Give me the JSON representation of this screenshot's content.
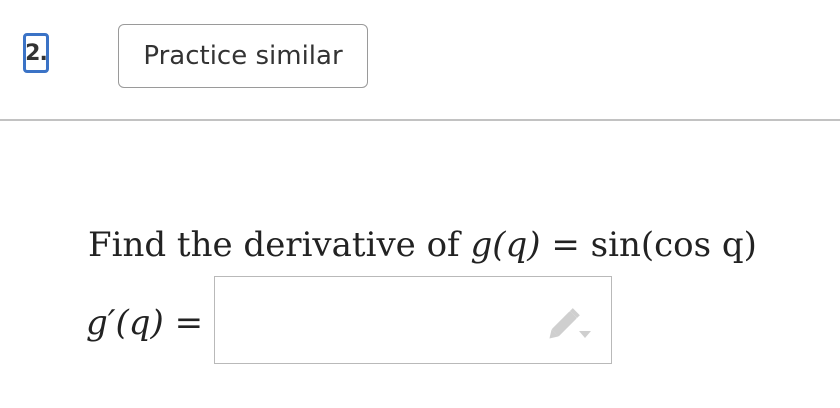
{
  "question": {
    "number": "2.",
    "practice_label": "Practice similar",
    "prompt_text": "Find the derivative of ",
    "function_lhs": "g(q)",
    "equals": "=",
    "function_rhs": "sin(cos q)",
    "answer_lhs": "g′(q)",
    "answer_equals": "="
  },
  "answer_input": {
    "value": "",
    "tool_icon": "pencil-icon"
  },
  "colors": {
    "number_border": "#3b73c6",
    "divider": "#c2c2c2",
    "icon": "#cfcfcf"
  }
}
